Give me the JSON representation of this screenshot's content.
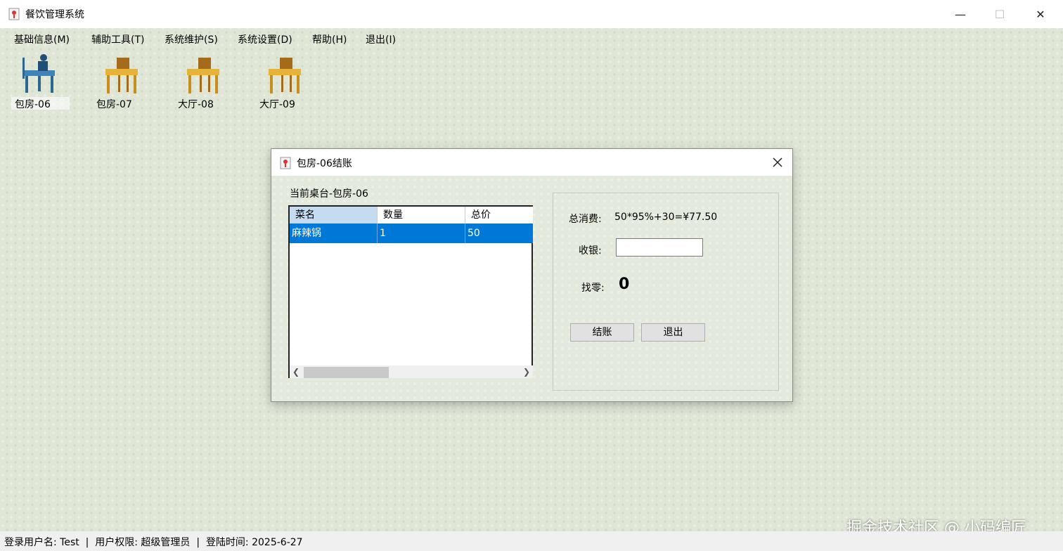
{
  "window": {
    "title": "餐饮管理系统",
    "minimize": "—",
    "maximize": "☐",
    "close": "✕"
  },
  "menu": {
    "items": [
      "基础信息(M)",
      "辅助工具(T)",
      "系统维护(S)",
      "系统设置(D)",
      "帮助(H)",
      "退出(I)"
    ]
  },
  "tables": [
    {
      "label": "包房-06",
      "status": "occupied",
      "color": "#3f84b8"
    },
    {
      "label": "包房-07",
      "status": "free",
      "color": "#e5b23a"
    },
    {
      "label": "大厅-08",
      "status": "free",
      "color": "#e5b23a"
    },
    {
      "label": "大厅-09",
      "status": "free",
      "color": "#e5b23a"
    }
  ],
  "dialog": {
    "title": "包房-06结账",
    "current_table": "当前桌台-包房-06",
    "grid": {
      "columns": [
        "菜名",
        "数量",
        "总价"
      ],
      "rows": [
        [
          "麻辣锅",
          "1",
          "50"
        ]
      ]
    },
    "total_label": "总消费:",
    "total_value": "50*95%+30=¥77.50",
    "cash_label": "收银:",
    "cash_value": "",
    "change_label": "找零:",
    "change_value": "0",
    "checkout_button": "结账",
    "exit_button": "退出"
  },
  "status": {
    "text": "登录用户名: Test  |  用户权限: 超级管理员  |  登陆时间: 2025-6-27"
  },
  "watermark": "掘金技术社区 @ 小码编匠",
  "colors": {
    "selection": "#0078d7",
    "background": "#dfe6d6"
  }
}
